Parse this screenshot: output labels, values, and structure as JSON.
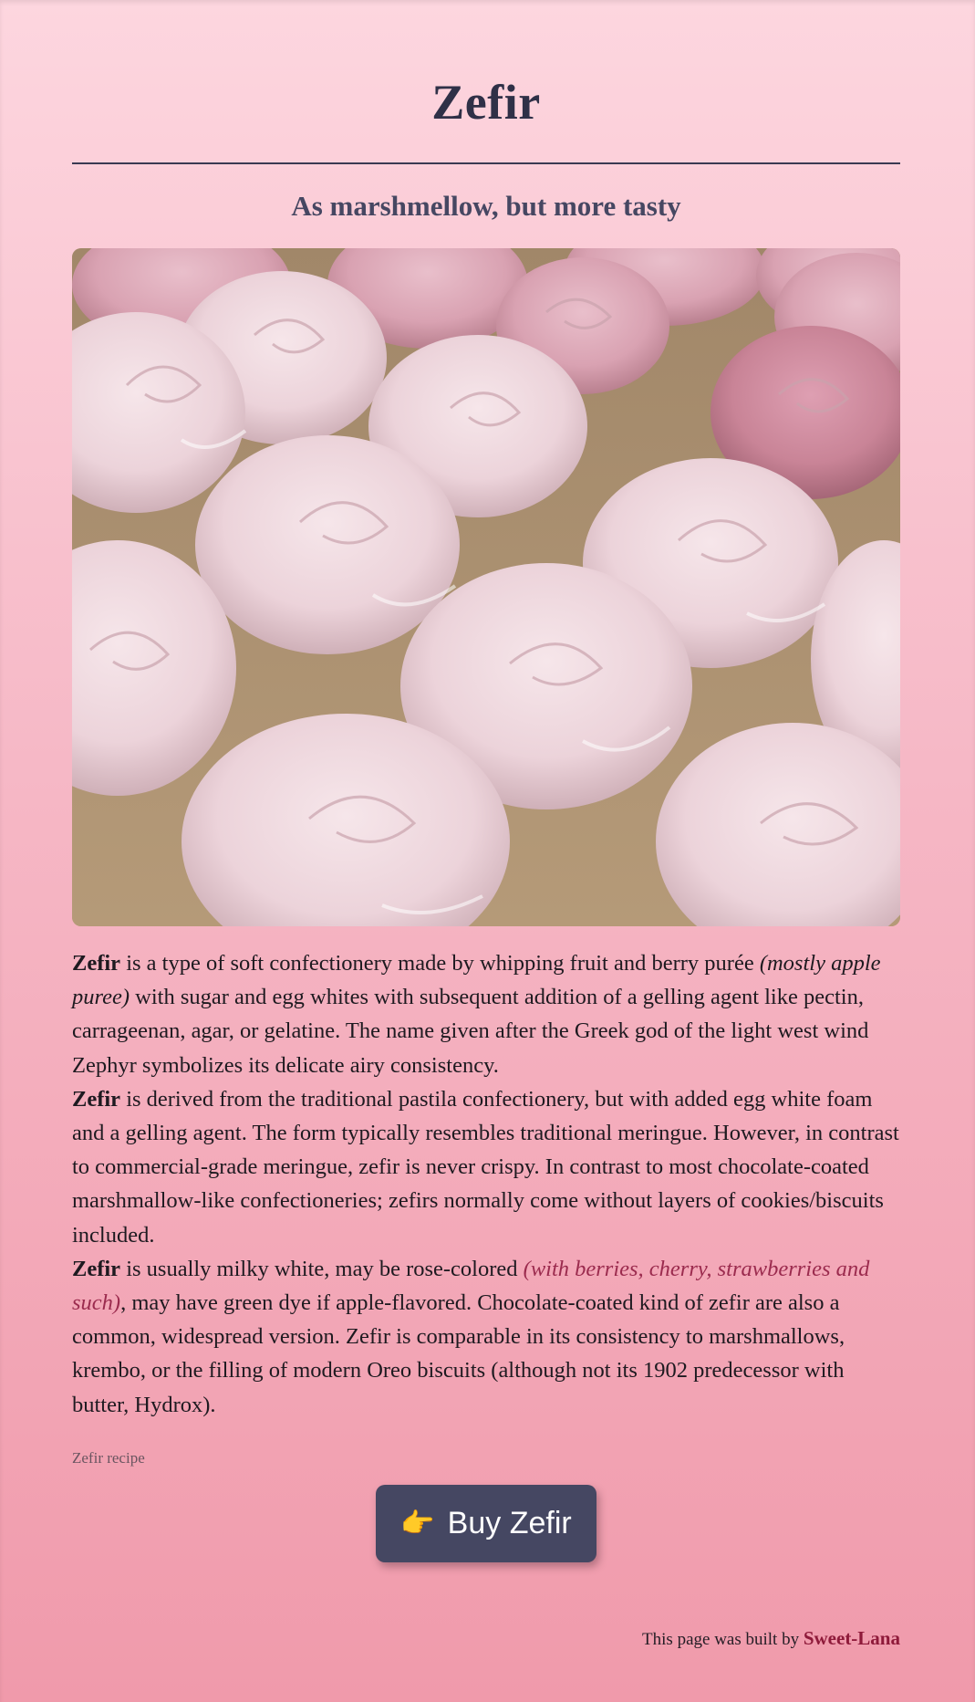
{
  "page": {
    "title": "Zefir",
    "subtitle": "As marshmellow, but more tasty"
  },
  "hero_image": {
    "icon": "meringue-photo"
  },
  "article": {
    "p1": {
      "lead": "Zefir",
      "t1": " is a type of soft confectionery made by whipping fruit and berry purée ",
      "aside": "(mostly apple puree)",
      "t2": " with sugar and egg whites with subsequent addition of a gelling agent like pectin, carrageenan, agar, or gelatine. The name given after the Greek god of the light west wind Zephyr symbolizes its delicate airy consistency."
    },
    "p2": {
      "lead": "Zefir",
      "t1": " is derived from the traditional pastila confectionery, but with added egg white foam and a gelling agent. The form typically resembles traditional meringue. However, in contrast to commercial-grade meringue, zefir is never crispy. In contrast to most chocolate-coated marshmallow-like confectioneries; zefirs normally come without layers of cookies/biscuits included."
    },
    "p3": {
      "lead": "Zefir",
      "t1": " is usually milky white, may be rose-colored ",
      "aside": "(with berries, cherry, strawberries and such)",
      "t2": ", may have green dye if apple-flavored. Chocolate-coated kind of zefir are also a common, widespread version. Zefir is comparable in its consistency to marshmallows, krembo, or the filling of modern Oreo biscuits (although not its 1902 predecessor with butter, Hydrox)."
    }
  },
  "recipe_link": "Zefir recipe",
  "buy_button": {
    "icon": "pointing-hand-icon",
    "glyph": "👉",
    "label": "Buy Zefir"
  },
  "footer": {
    "text": "This page was built by ",
    "author": "Sweet-Lana"
  },
  "colors": {
    "title": "#2f3047",
    "button_bg": "#454762",
    "accent": "#9b2b4e",
    "author": "#8e1a3a"
  }
}
